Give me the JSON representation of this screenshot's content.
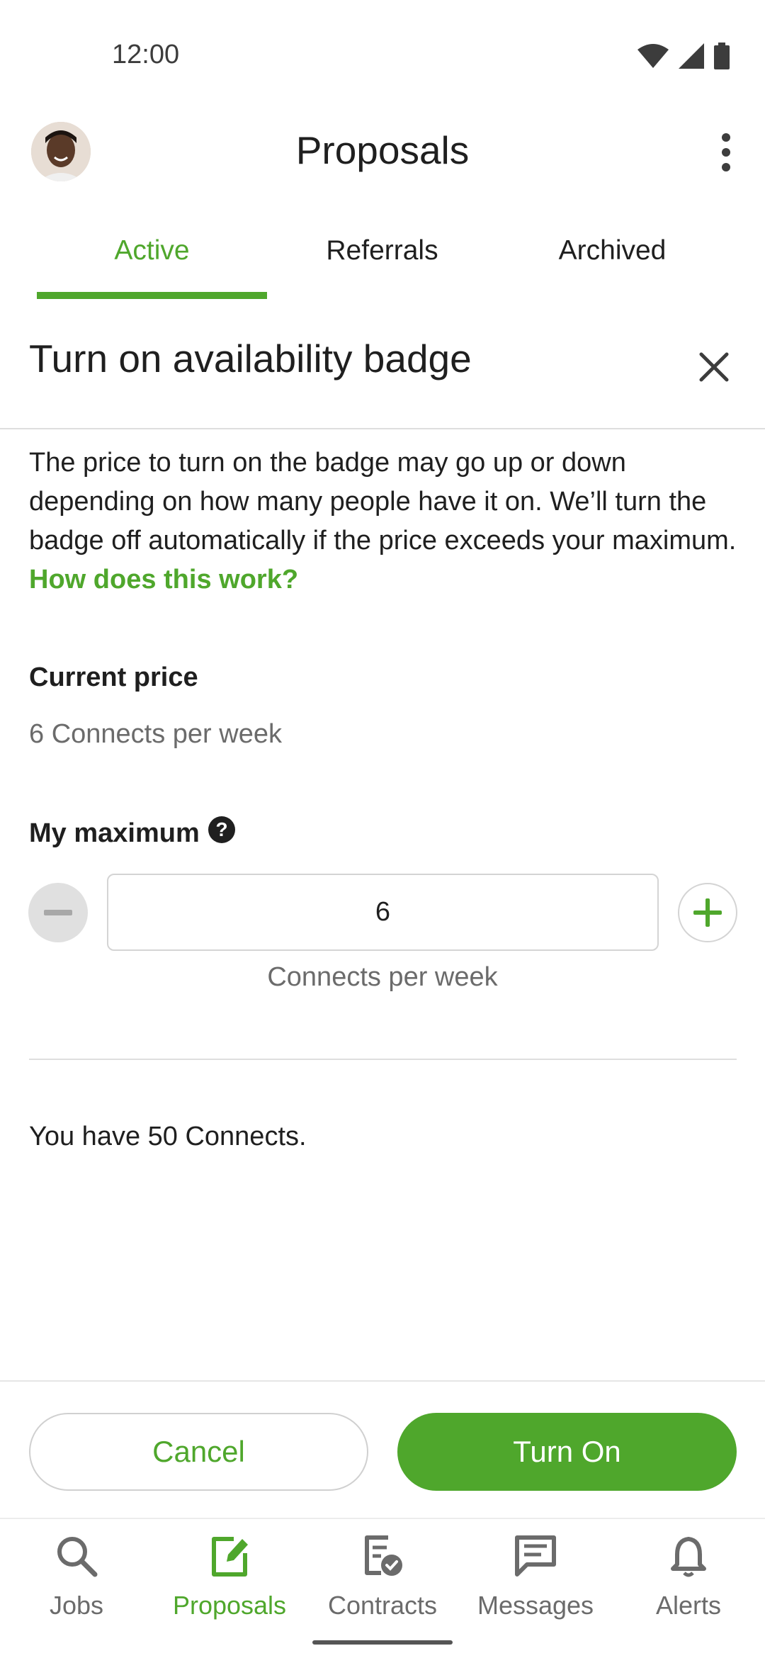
{
  "status_bar": {
    "time": "12:00",
    "icons": [
      "wifi-icon",
      "cellular-signal-icon",
      "battery-icon"
    ]
  },
  "app_bar": {
    "title": "Proposals",
    "avatar": "user-avatar",
    "menu_icon": "more-vert-icon"
  },
  "tabs": [
    {
      "label": "Active",
      "active": true
    },
    {
      "label": "Referrals",
      "active": false
    },
    {
      "label": "Archived",
      "active": false
    }
  ],
  "sheet": {
    "title": "Turn on availability badge",
    "close_icon": "close-icon",
    "description": "The price to turn on the badge may go up or down depending on how many people have it on. We’ll turn the badge off automatically if the price exceeds your maximum.",
    "description_link": "How does this work?",
    "current_price_label": "Current price",
    "current_price_value": "6 Connects per week",
    "maximum_label": "My maximum",
    "help_icon": "help-circle-icon",
    "maximum_value": "6",
    "maximum_unit": "Connects per week",
    "balance": "You have 50 Connects."
  },
  "actions": {
    "cancel_label": "Cancel",
    "confirm_label": "Turn On"
  },
  "bottom_nav": [
    {
      "label": "Jobs",
      "icon": "search-icon",
      "active": false
    },
    {
      "label": "Proposals",
      "icon": "edit-document-icon",
      "active": true
    },
    {
      "label": "Contracts",
      "icon": "contract-check-icon",
      "active": false
    },
    {
      "label": "Messages",
      "icon": "message-icon",
      "active": false
    },
    {
      "label": "Alerts",
      "icon": "bell-icon",
      "active": false
    }
  ],
  "colors": {
    "accent": "#4fa72c",
    "text_primary": "#1f1f1f",
    "text_secondary": "#6b6b6b",
    "divider": "#dedede"
  }
}
